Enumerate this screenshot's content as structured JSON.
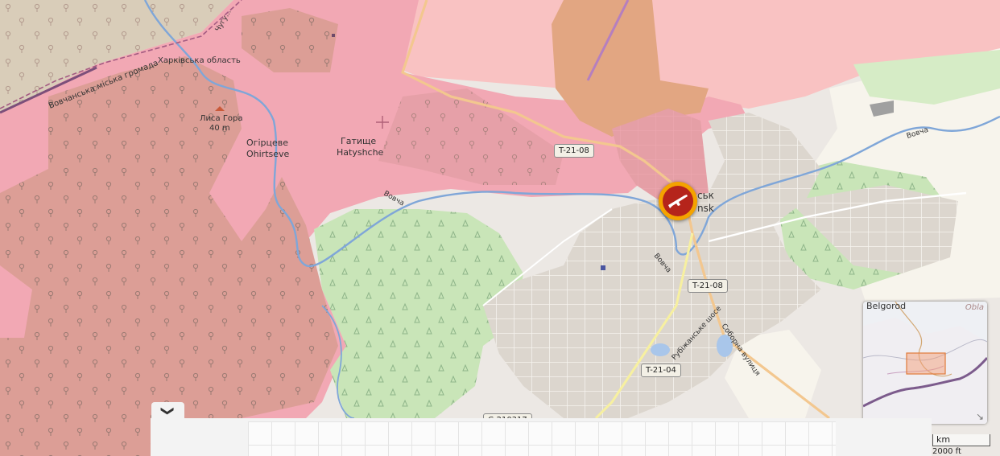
{
  "map": {
    "colors": {
      "background": "#ece8e4",
      "occupied": "#f2a8b4",
      "occupied_forest": "#dc9e96",
      "occupied_tan": "#e2a682",
      "contested": "#f9c2c2",
      "forest": "#c9e5b8",
      "urban": "#dcd6ce",
      "river": "#7fa6d8",
      "road": "#f3c78f"
    },
    "labels": {
      "hromada_boundary": "Вовчанська міська громада",
      "oblast_boundary": "Харківська область",
      "river_top": "Чугу...",
      "hill_name": "Лиса Гора",
      "hill_elevation": "40 m",
      "village1_uk": "Огірцеве",
      "village1_en": "Ohirtseve",
      "village2_uk": "Гатище",
      "village2_en": "Hatyshche",
      "river_vovcha_1": "Вовча",
      "river_vovcha_2": "Вовча",
      "river_vovcha_3": "Вовча",
      "city_partial_uk": "ськ",
      "city_partial_en": "nsk",
      "street_1": "Рубіжанське шосе",
      "street_2": "Соборна вулиця"
    },
    "road_shields": {
      "t2108_north": "T-21-08",
      "t2108_south": "T-21-08",
      "t2104": "T-21-04",
      "c21_partial": "C-210317"
    },
    "marker": {
      "icon": "rifle-icon",
      "type": "combat-event"
    }
  },
  "minimap": {
    "title": "Belgorod",
    "region_label": "Obla",
    "expand_icon": "↘"
  },
  "bottom_panel": {
    "toggle_icon": "❯"
  },
  "scale": {
    "metric": "km",
    "imperial": "2000 ft"
  }
}
